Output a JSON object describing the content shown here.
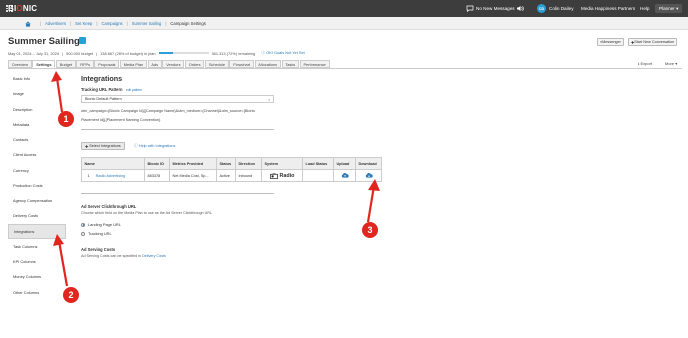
{
  "topbar": {
    "logo": "BIONIC",
    "messages": "No New Messages",
    "user_initials": "CD",
    "user_name": "Colin Dailey",
    "org": "Media Happiness Partners",
    "help": "Help",
    "planner": "Planner"
  },
  "breadcrumb": [
    "Advertisers",
    "Set Keep",
    "Campaigns",
    "Summer Sailing",
    "Campaign Settings"
  ],
  "header": {
    "title": "Summer Sailing",
    "dates": "May 01, 2024 – July 31, 2024",
    "budget": "500.000 budget",
    "in_plan": "138.667 (28% of budget) in plan",
    "remaining": "361.313 (72%) remaining",
    "plan_fraction": 0.28,
    "goal_link": "OKI Goals Not Yet Set",
    "messenger": "Messenger",
    "new_conversation": "Start New Conversation"
  },
  "tabs": [
    "Overview",
    "Settings",
    "Budget",
    "RFPs",
    "Proposals",
    "Media Plan",
    "Ads",
    "Vendors",
    "Orders",
    "Schedule",
    "Flowchart",
    "Allocations",
    "Tasks",
    "Performance"
  ],
  "active_tab": "Settings",
  "toolbar": {
    "export": "Export",
    "more": "More"
  },
  "sidebar": [
    "Basic Info",
    "Image",
    "Description",
    "Metadata",
    "Contacts",
    "Client Access",
    "Currency",
    "Production Costs",
    "Agency Compensation",
    "Delivery Costs",
    "Integrations",
    "Task Columns",
    "KPI Columns",
    "Money Columns",
    "Other Columns"
  ],
  "active_sidebar": "Integrations",
  "main": {
    "heading": "Integrations",
    "tracking_label": "Tracking URL Pattern",
    "tracking_edit": "edit pattern",
    "tracking_select": "Bionic Default Pattern",
    "tracking_url_line1": "utm_campaign={Bionic Campaign Id}[{Campaign Name}&utm_medium={Channel}&utm_source={Bionic",
    "tracking_url_line2": "Placement Id}[{Placement Naming Convention}",
    "select_integrations": "Select Integrations",
    "help_link": "Help with Integrations",
    "table_headers": [
      "Name",
      "Bionic ID",
      "Metrics Provided",
      "Status",
      "Direction",
      "System",
      "Load Status",
      "Upload",
      "Download"
    ],
    "table_row": {
      "num": "1",
      "name": "Radio Advertising",
      "bionic_id": "883378",
      "metrics": "Net Media Cost, Sp...",
      "status": "Active",
      "direction": "Inbound",
      "system": "Radio",
      "load_status": ""
    },
    "ad_server_title": "Ad Server Clickthrough URL",
    "ad_server_desc": "Choose which field on the Media Plan to use as the Ad Server Clickthrough URL",
    "radio_options": [
      "Landing Page URL",
      "Tracking URL"
    ],
    "serving_title": "Ad Serving Costs",
    "serving_desc": "Ad Serving Costs can be specified in",
    "serving_link": "Delivery Costs"
  },
  "annotations": [
    "1",
    "2",
    "3"
  ],
  "colors": {
    "accent": "#2a7ab8",
    "annotation": "#e0261f",
    "topbar": "#3d3d3d"
  }
}
